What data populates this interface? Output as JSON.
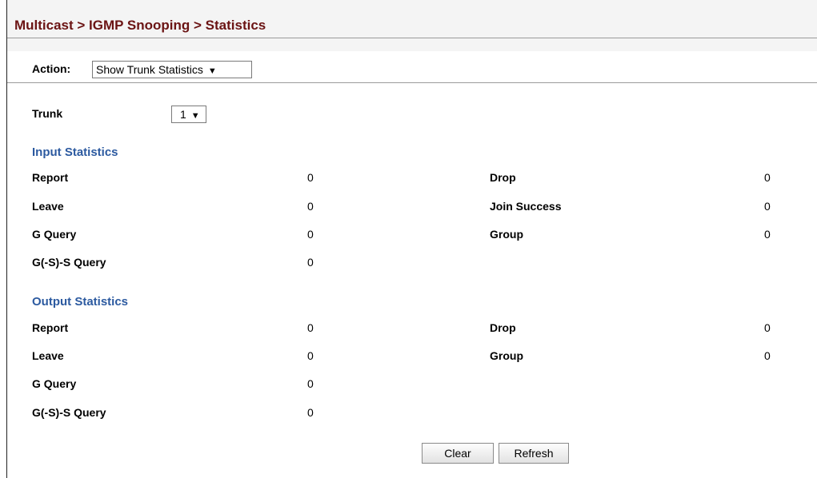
{
  "breadcrumb": "Multicast > IGMP Snooping > Statistics",
  "action": {
    "label": "Action:",
    "value": "Show Trunk Statistics",
    "arrow": "▼"
  },
  "trunk": {
    "label": "Trunk",
    "value": "1",
    "arrow": "▼"
  },
  "input_statistics": {
    "title": "Input Statistics",
    "left": [
      {
        "label": "Report",
        "value": "0"
      },
      {
        "label": "Leave",
        "value": "0"
      },
      {
        "label": "G Query",
        "value": "0"
      },
      {
        "label": "G(-S)-S Query",
        "value": "0"
      }
    ],
    "right": [
      {
        "label": "Drop",
        "value": "0"
      },
      {
        "label": "Join Success",
        "value": "0"
      },
      {
        "label": "Group",
        "value": "0"
      }
    ]
  },
  "output_statistics": {
    "title": "Output Statistics",
    "left": [
      {
        "label": "Report",
        "value": "0"
      },
      {
        "label": "Leave",
        "value": "0"
      },
      {
        "label": "G Query",
        "value": "0"
      },
      {
        "label": "G(-S)-S Query",
        "value": "0"
      }
    ],
    "right": [
      {
        "label": "Drop",
        "value": "0"
      },
      {
        "label": "Group",
        "value": "0"
      }
    ]
  },
  "buttons": {
    "clear": "Clear",
    "refresh": "Refresh"
  },
  "colors": {
    "title": "#6b1414",
    "section_title": "#2c5aa0",
    "header_background": "#f4f4f4"
  }
}
